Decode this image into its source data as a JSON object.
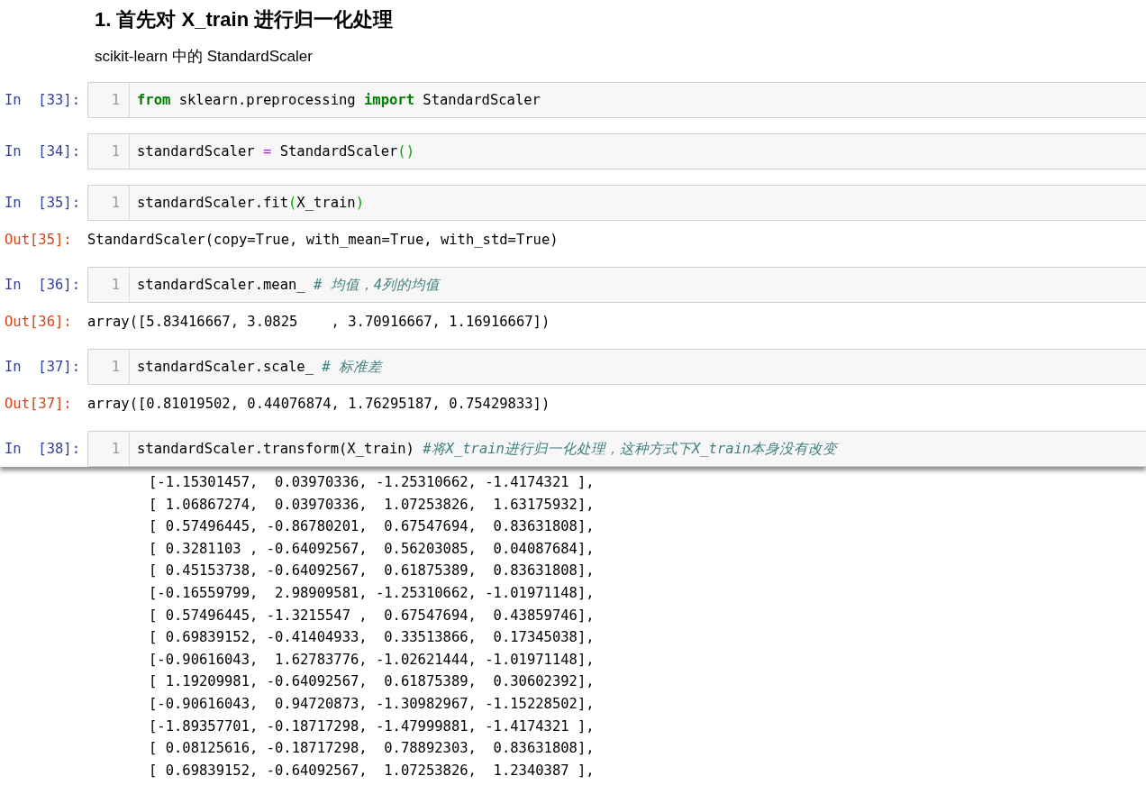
{
  "heading": "1. 首先对 X_train 进行归一化处理",
  "paragraph": "scikit-learn 中的 StandardScaler",
  "cells": [
    {
      "prompt": "In  [33]:",
      "line_number": "1",
      "tokens": [
        {
          "kind": "keyword",
          "text": "from"
        },
        {
          "kind": "plain",
          "text": " sklearn.preprocessing "
        },
        {
          "kind": "keyword",
          "text": "import"
        },
        {
          "kind": "plain",
          "text": " StandardScaler"
        }
      ]
    },
    {
      "prompt": "In  [34]:",
      "line_number": "1",
      "tokens": [
        {
          "kind": "plain",
          "text": "standardScaler "
        },
        {
          "kind": "operator",
          "text": "="
        },
        {
          "kind": "plain",
          "text": " StandardScaler"
        },
        {
          "kind": "paren",
          "text": "()"
        }
      ]
    },
    {
      "prompt": "In  [35]:",
      "line_number": "1",
      "tokens": [
        {
          "kind": "plain",
          "text": "standardScaler.fit"
        },
        {
          "kind": "paren",
          "text": "("
        },
        {
          "kind": "plain",
          "text": "X_train"
        },
        {
          "kind": "paren",
          "text": ")"
        }
      ],
      "output": {
        "prompt": "Out[35]:",
        "text": "StandardScaler(copy=True, with_mean=True, with_std=True)"
      }
    },
    {
      "prompt": "In  [36]:",
      "line_number": "1",
      "tokens": [
        {
          "kind": "plain",
          "text": "standardScaler.mean_ "
        },
        {
          "kind": "comment",
          "text": "# 均值，4列的均值"
        }
      ],
      "output": {
        "prompt": "Out[36]:",
        "text": "array([5.83416667, 3.0825    , 3.70916667, 1.16916667])"
      }
    },
    {
      "prompt": "In  [37]:",
      "line_number": "1",
      "tokens": [
        {
          "kind": "plain",
          "text": "standardScaler.scale_ "
        },
        {
          "kind": "comment",
          "text": "# 标准差"
        }
      ],
      "output": {
        "prompt": "Out[37]:",
        "text": "array([0.81019502, 0.44076874, 1.76295187, 0.75429833])"
      }
    },
    {
      "prompt": "In  [38]:",
      "line_number": "1",
      "tokens": [
        {
          "kind": "plain",
          "text": "standardScaler.transform(X_train) "
        },
        {
          "kind": "comment",
          "text": "#将X_train进行归一化处理，这种方式下X_train本身没有改变"
        }
      ]
    }
  ],
  "output_lines": [
    "[-1.15301457,  0.03970336, -1.25310662, -1.4174321 ],",
    "[ 1.06867274,  0.03970336,  1.07253826,  1.63175932],",
    "[ 0.57496445, -0.86780201,  0.67547694,  0.83631808],",
    "[ 0.3281103 , -0.64092567,  0.56203085,  0.04087684],",
    "[ 0.45153738, -0.64092567,  0.61875389,  0.83631808],",
    "[-0.16559799,  2.98909581, -1.25310662, -1.01971148],",
    "[ 0.57496445, -1.3215547 ,  0.67547694,  0.43859746],",
    "[ 0.69839152, -0.41404933,  0.33513866,  0.17345038],",
    "[-0.90616043,  1.62783776, -1.02621444, -1.01971148],",
    "[ 1.19209981, -0.64092567,  0.61875389,  0.30602392],",
    "[-0.90616043,  0.94720873, -1.30982967, -1.15228502],",
    "[-1.89357701, -0.18717298, -1.47999881, -1.4174321 ],",
    "[ 0.08125616, -0.18717298,  0.78892303,  0.83631808],",
    "[ 0.69839152, -0.64092567,  1.07253826,  1.2340387 ],"
  ]
}
